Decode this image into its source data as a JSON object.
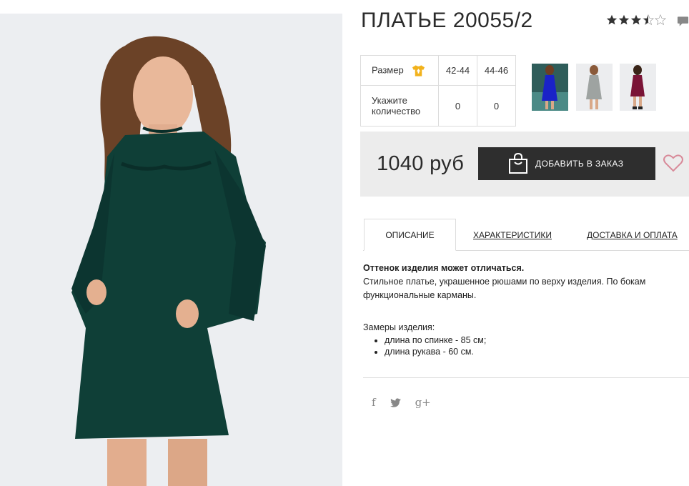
{
  "product": {
    "title": "ПЛАТЬЕ 20055/2",
    "rating": 3.5,
    "rating_max": 5,
    "image_alt": "dark green dress photo"
  },
  "size_table": {
    "size_label": "Размер",
    "quantity_label_1": "Укажите",
    "quantity_label_2": "количество",
    "sizes": [
      "42-44",
      "44-46"
    ],
    "quantities": [
      "0",
      "0"
    ]
  },
  "thumbnails": [
    {
      "name": "blue-dress",
      "color": "#1a22c8"
    },
    {
      "name": "grey-dress",
      "color": "#9ea3a1"
    },
    {
      "name": "burgundy-dress",
      "color": "#7a1436"
    }
  ],
  "buy": {
    "price": "1040 руб",
    "add_label": "ДОБАВИТЬ В ЗАКАЗ"
  },
  "tabs": {
    "description": "ОПИСАНИЕ",
    "characteristics": "ХАРАКТЕРИСТИКИ",
    "delivery": "ДОСТАВКА И ОПЛАТА"
  },
  "description": {
    "note": "Оттенок изделия может отличаться.",
    "line1": "Стильное платье, украшенное рюшами по верху изделия. По бокам",
    "line2": "функциональные карманы.",
    "measurements_title": "Замеры изделия:",
    "measurements": [
      "длина по спинке - 85 см;",
      "длина рукава - 60 см."
    ]
  },
  "social": {
    "facebook": "f",
    "twitter": "t",
    "gplus": "g+"
  },
  "colors": {
    "dress": "#0f3f37",
    "star": "#333333",
    "heart": "#d88a99",
    "tshirt": "#f2b21c"
  }
}
